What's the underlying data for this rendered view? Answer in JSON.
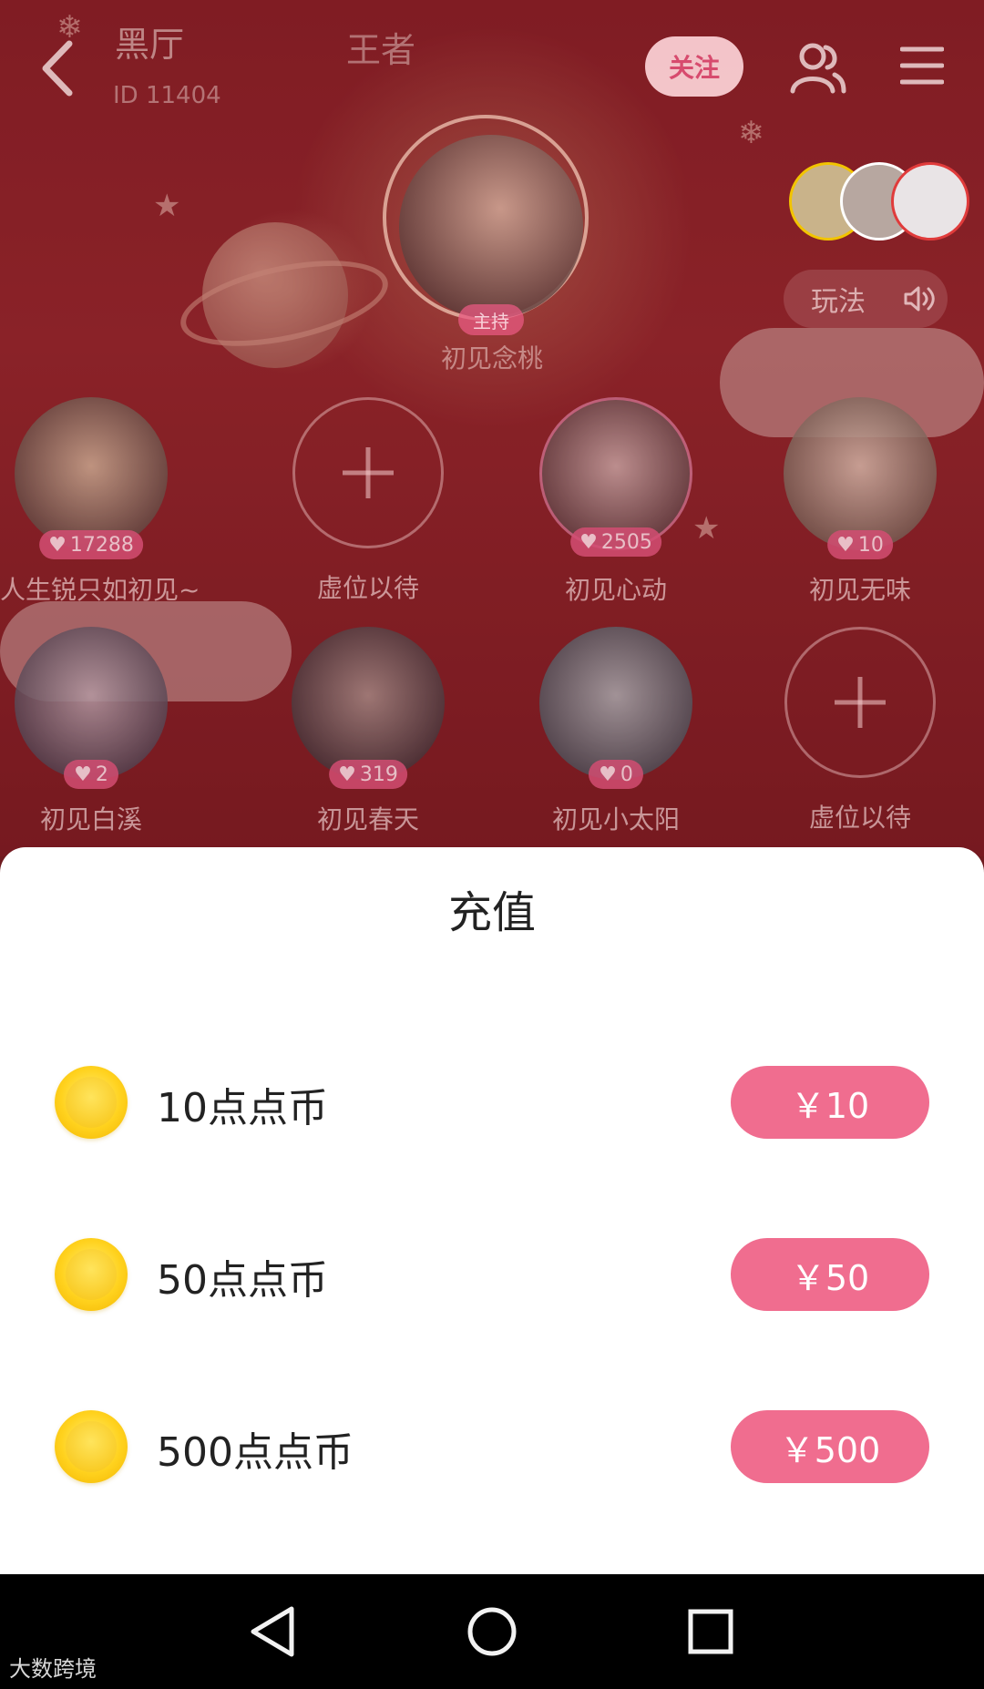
{
  "room": {
    "title": "黑厅",
    "id_text": "ID 11404",
    "subtitle": "王者",
    "follow_label": "关注",
    "wanfa_label": "玩法"
  },
  "host": {
    "tag": "主持",
    "name": "初见念桃"
  },
  "seats_row1": [
    {
      "name": "人生锐只如初见~",
      "hearts": "17288",
      "empty": false,
      "color": "#c9a78f"
    },
    {
      "name": "虚位以待",
      "hearts": "",
      "empty": true,
      "color": ""
    },
    {
      "name": "初见心动",
      "hearts": "2505",
      "empty": false,
      "color": "#b5878a"
    },
    {
      "name": "初见无味",
      "hearts": "10",
      "empty": false,
      "color": "#d2b3a5"
    }
  ],
  "seats_row2": [
    {
      "name": "初见白溪",
      "hearts": "2",
      "empty": false,
      "color": "#a9878f"
    },
    {
      "name": "初见春天",
      "hearts": "319",
      "empty": false,
      "color": "#8f6f72"
    },
    {
      "name": "初见小太阳",
      "hearts": "0",
      "empty": false,
      "color": "#8d8f95"
    },
    {
      "name": "虚位以待",
      "hearts": "",
      "empty": true,
      "color": ""
    }
  ],
  "recharge": {
    "title": "充值",
    "options": [
      {
        "label": "10点点币",
        "price": "￥10"
      },
      {
        "label": "50点点币",
        "price": "￥50"
      },
      {
        "label": "500点点币",
        "price": "￥500"
      }
    ]
  },
  "watermark": "大数跨境",
  "colors": {
    "accent": "#f06d8f",
    "coin": "#ffd21e",
    "room_bg": "#8c2229"
  }
}
